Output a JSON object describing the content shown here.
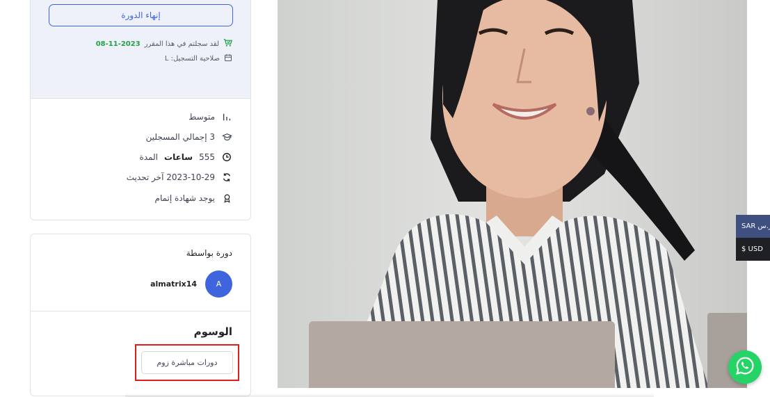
{
  "sidebar": {
    "finish_button": "إنهاء الدورة",
    "enrolled_text": "لقد سجلتم في هذا المقرر",
    "enrolled_date": "08-11-2023",
    "validity_text": "صلاحية التسجيل: L",
    "level": "متوسط",
    "total_enrolled": "3 إجمالي المسجلين",
    "duration_value": "555",
    "duration_unit": "ساعات",
    "duration_label": "المدة",
    "last_update": "2023-10-29 آخر تحديث",
    "certificate": "يوجد شهادة إتمام"
  },
  "instructor": {
    "by_label": "دورة بواسطة",
    "avatar_letter": "A",
    "name": "almatrix14"
  },
  "tags": {
    "title": "الوسوم",
    "items": [
      "دورات مباشرة زوم"
    ]
  },
  "currency": {
    "sar": "SAR ر.س",
    "usd": "$ USD"
  },
  "colors": {
    "primary": "#3e64de",
    "success": "#24a148",
    "highlight": "#e21b1b",
    "whatsapp": "#25d366"
  },
  "icons": [
    "cart-check-icon",
    "calendar-icon",
    "level-bars-icon",
    "graduation-cap-icon",
    "clock-icon",
    "refresh-icon",
    "certificate-icon",
    "whatsapp-icon"
  ]
}
